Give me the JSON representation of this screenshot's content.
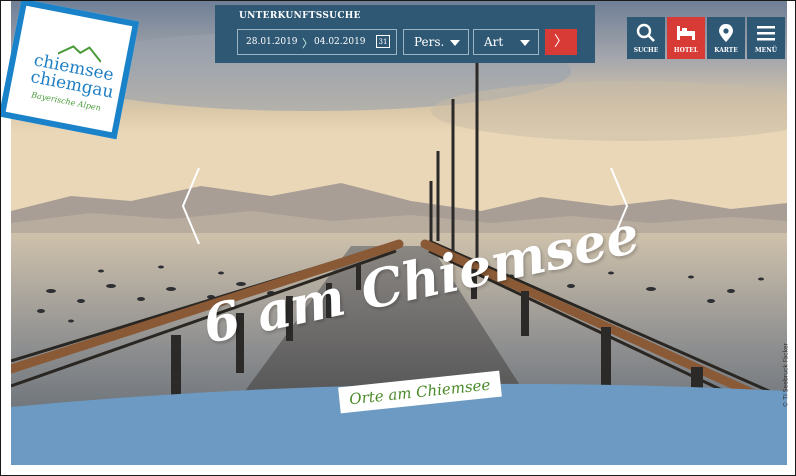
{
  "logo": {
    "line1": "chiemsee",
    "line2": "chiemgau",
    "tagline": "Bayerische Alpen"
  },
  "search": {
    "title": "UNTERKUNFTSSUCHE",
    "date_from": "28.01.2019",
    "date_to": "04.02.2019",
    "calendar_icon": "31",
    "persons_label": "Pers.",
    "type_label": "Art",
    "submit_icon": "chevron-right-icon"
  },
  "nav": [
    {
      "label": "SUCHE",
      "icon": "search-icon"
    },
    {
      "label": "HOTEL",
      "icon": "bed-icon"
    },
    {
      "label": "KARTE",
      "icon": "map-pin-icon"
    },
    {
      "label": "MENÜ",
      "icon": "menu-icon"
    }
  ],
  "hero": {
    "headline": "6 am Chiemsee",
    "subheadline": "Orte am Chiemsee",
    "photo_credit": "© TI Seebruck Fäcker"
  },
  "colors": {
    "navy": "#2f5875",
    "red": "#d83a35",
    "blue_band": "#6d9ac2",
    "logo_blue": "#1f7fc4",
    "green": "#4a8a2a"
  }
}
